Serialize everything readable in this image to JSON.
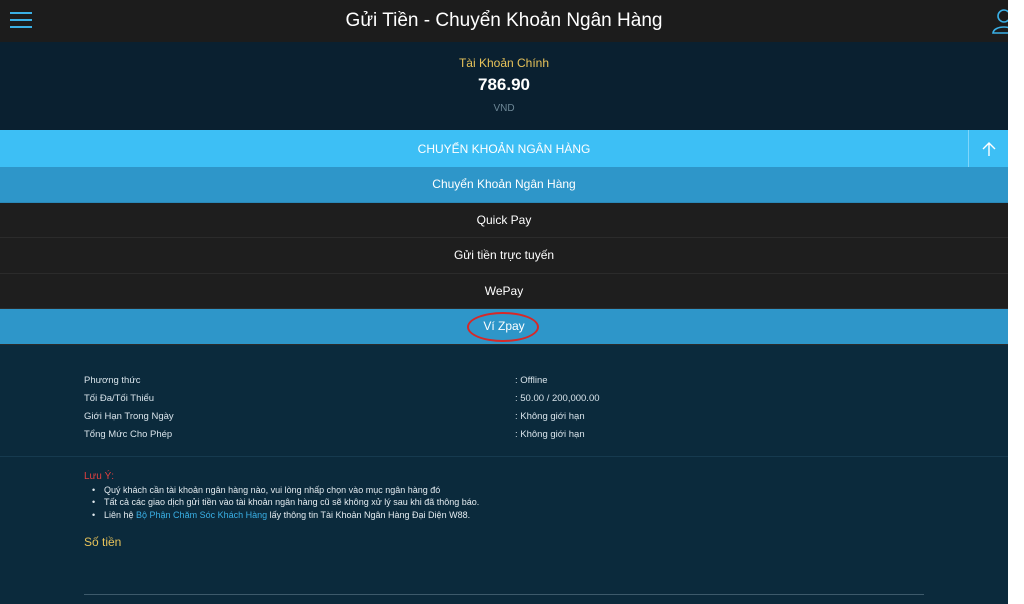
{
  "header": {
    "title": "Gửi Tiền - Chuyển Khoản Ngân Hàng",
    "menu_icon": "hamburger-icon",
    "user_icon": "user-icon",
    "accent_color": "#3ab0e6"
  },
  "balance": {
    "label": "Tài Khoản Chính",
    "amount": "786.90",
    "currency": "VND"
  },
  "section": {
    "title": "CHUYỂN KHOẢN NGÂN HÀNG",
    "collapse_icon": "arrow-up-icon",
    "color": "#3dbff5"
  },
  "methods": [
    {
      "label": "Chuyển Khoản Ngân Hàng",
      "state": "active"
    },
    {
      "label": "Quick Pay",
      "state": "normal"
    },
    {
      "label": "Gửi tiền trực tuyến",
      "state": "normal"
    },
    {
      "label": "WePay",
      "state": "normal"
    },
    {
      "label": "Ví Zpay",
      "state": "selected"
    }
  ],
  "details": [
    {
      "label": "Phương thức",
      "value": ": Offline"
    },
    {
      "label": "Tối Đa/Tối Thiểu",
      "value": ": 50.00 / 200,000.00"
    },
    {
      "label": "Giới Hạn Trong Ngày",
      "value": ": Không giới hạn"
    },
    {
      "label": "Tổng Mức Cho Phép",
      "value": ": Không giới hạn"
    }
  ],
  "notes": {
    "title": "Lưu Ý:",
    "items": [
      "Quý khách cần tài khoản ngân hàng nào, vui lòng nhấp chọn vào mục ngân hàng đó",
      "Tất cả các giao dịch gửi tiền vào tài khoản ngân hàng cũ sẽ không xử lý sau khi đã thông báo."
    ],
    "contact_prefix": "Liên hệ ",
    "contact_link": "Bộ Phận Chăm Sóc Khách Hàng",
    "contact_suffix": " lấy thông tin Tài Khoản Ngân Hàng Đại Diện W88."
  },
  "amount": {
    "label": "Số tiền"
  },
  "colors": {
    "note_title": "#e34040",
    "highlight_circle": "#d62828",
    "gold": "#e8c35a"
  }
}
